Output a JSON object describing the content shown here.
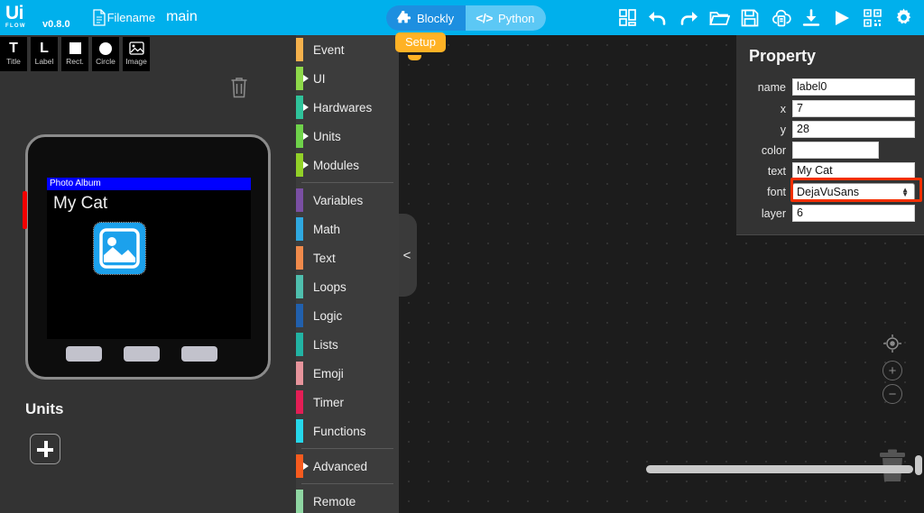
{
  "header": {
    "logo_main": "Ui",
    "logo_sub": "FLOW",
    "version": "v0.8.0",
    "file_label": "Filename",
    "file_name": "main",
    "file_icon": "document-icon",
    "mode_toggle": {
      "blockly_label": "Blockly",
      "blockly_icon": "puzzle-icon",
      "python_label": "Python",
      "python_icon": "code-brackets-icon",
      "active": "Blockly"
    },
    "accent_color": "#00b0ec",
    "toolbar": [
      {
        "name": "layout-blocks-icon",
        "title": "Blocks layout"
      },
      {
        "name": "undo-icon",
        "title": "Undo"
      },
      {
        "name": "redo-icon",
        "title": "Redo"
      },
      {
        "name": "open-folder-icon",
        "title": "Open"
      },
      {
        "name": "save-disk-icon",
        "title": "Save"
      },
      {
        "name": "cloud-icon",
        "title": "Cloud"
      },
      {
        "name": "download-icon",
        "title": "Download"
      },
      {
        "name": "run-play-icon",
        "title": "Run"
      },
      {
        "name": "qr-code-icon",
        "title": "QR Code"
      },
      {
        "name": "settings-gear-icon",
        "title": "Settings"
      }
    ]
  },
  "left_panel": {
    "ui_tools": [
      {
        "label": "Title",
        "icon": "title-t-icon"
      },
      {
        "label": "Label",
        "icon": "label-l-icon"
      },
      {
        "label": "Rect.",
        "icon": "rectangle-icon"
      },
      {
        "label": "Circle",
        "icon": "circle-icon"
      },
      {
        "label": "Image",
        "icon": "image-icon"
      }
    ],
    "trash_icon": "trash-icon",
    "device": {
      "screen_title": "Photo Album",
      "screen_title_bg": "#0000ff",
      "label_text": "My Cat",
      "image_placeholder_icon": "image-placeholder-icon",
      "image_placeholder_color": "#1ca1ec",
      "button_count": 3,
      "side_led_color": "#f50000"
    },
    "units": {
      "title": "Units",
      "add_label": "+"
    }
  },
  "categories": [
    {
      "label": "Event",
      "color": "#f5b14c",
      "expandable": false
    },
    {
      "label": "UI",
      "color": "#8ed94a",
      "expandable": true
    },
    {
      "label": "Hardwares",
      "color": "#2fc39b",
      "expandable": true
    },
    {
      "label": "Units",
      "color": "#6fd24a",
      "expandable": true
    },
    {
      "label": "Modules",
      "color": "#92d128",
      "expandable": true
    },
    {
      "label": "Variables",
      "color": "#7a4fa3",
      "expandable": false
    },
    {
      "label": "Math",
      "color": "#2fa8e0",
      "expandable": false
    },
    {
      "label": "Text",
      "color": "#f08a4b",
      "expandable": false
    },
    {
      "label": "Loops",
      "color": "#4fbfae",
      "expandable": false
    },
    {
      "label": "Logic",
      "color": "#2160ad",
      "expandable": false
    },
    {
      "label": "Lists",
      "color": "#22b3a3",
      "expandable": false
    },
    {
      "label": "Emoji",
      "color": "#e7949c",
      "expandable": false
    },
    {
      "label": "Timer",
      "color": "#e31e55",
      "expandable": false
    },
    {
      "label": "Functions",
      "color": "#26d7ea",
      "expandable": false
    },
    {
      "label": "Advanced",
      "color": "#f75b1e",
      "expandable": true
    },
    {
      "label": "Remote",
      "color": "#8fd6a2",
      "expandable": false
    }
  ],
  "workspace": {
    "setup_block_label": "Setup",
    "setup_block_color": "#ffb225",
    "collapse_handle": "<",
    "zoom_center_icon": "target-center-icon",
    "zoom_in_label": "+",
    "zoom_out_label": "−",
    "trash_icon": "workspace-trash-icon"
  },
  "property": {
    "title": "Property",
    "rows": [
      {
        "key": "name",
        "value": "label0",
        "type": "text"
      },
      {
        "key": "x",
        "value": "7",
        "type": "text"
      },
      {
        "key": "y",
        "value": "28",
        "type": "text"
      },
      {
        "key": "color",
        "value": "",
        "type": "swatch"
      },
      {
        "key": "text",
        "value": "My Cat",
        "type": "text"
      },
      {
        "key": "font",
        "value": "DejaVuSans",
        "type": "select"
      },
      {
        "key": "layer",
        "value": "6",
        "type": "text"
      }
    ],
    "highlight_color": "#f42f00",
    "highlighted_row": "font"
  }
}
